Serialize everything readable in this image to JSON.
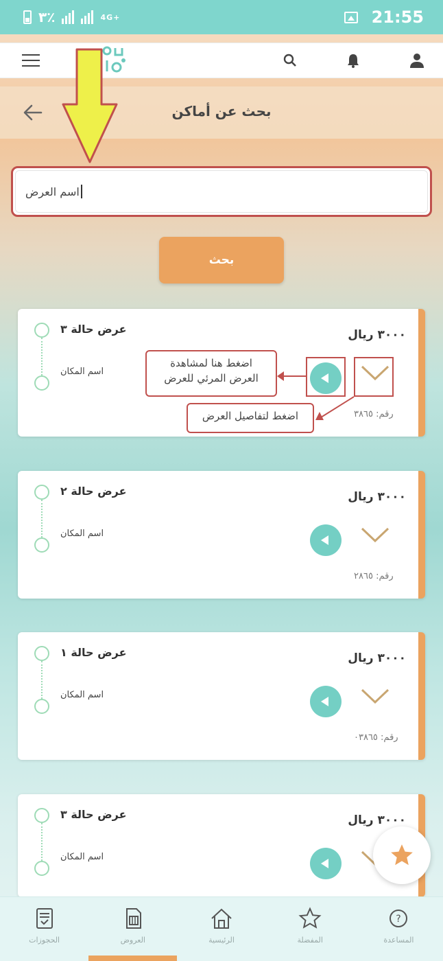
{
  "status_bar": {
    "battery_percent": "٣٪",
    "network": "4G+",
    "time": "21:55"
  },
  "header": {
    "logo_text": "ن\nا|ن",
    "icons": [
      "menu-icon",
      "search-icon",
      "bell-icon",
      "user-icon"
    ]
  },
  "subheader": {
    "title": "بحث عن أماكن"
  },
  "search": {
    "value": "اسم العرض"
  },
  "search_button": {
    "label": "بحث"
  },
  "cards": [
    {
      "from": "عرض حالة ٣",
      "to": "اسم المكان",
      "price": "٣٠٠٠ ريال",
      "code": "رقم: ٣٨٦٥"
    },
    {
      "from": "عرض حالة ٢",
      "to": "اسم المكان",
      "price": "٣٠٠٠ ريال",
      "code": "رقم: ٢٨٦٥"
    },
    {
      "from": "عرض حالة ١",
      "to": "اسم المكان",
      "price": "٣٠٠٠ ريال",
      "code": "رقم: ٠٣٨٦٥"
    },
    {
      "from": "عرض حالة ٣",
      "to": "اسم المكان",
      "price": "٣٠٠٠ ريال",
      "code": ""
    }
  ],
  "callouts": {
    "play": "اضغط هنا لمشاهدة\nالعرض المرئي للعرض",
    "chevron": "اضغط لتفاصيل العرض"
  },
  "bottom_nav": [
    {
      "label": "الحجوزات",
      "icon": "receipt-icon"
    },
    {
      "label": "العروض",
      "icon": "sim-card-icon"
    },
    {
      "label": "الرئيسية",
      "icon": "home-icon"
    },
    {
      "label": "المفضلة",
      "icon": "star-icon"
    },
    {
      "label": "المساعدة",
      "icon": "help-icon"
    }
  ],
  "colors": {
    "accent": "#eba35f",
    "teal": "#74cfc4",
    "annotation": "#c0504d",
    "status_bar": "#7fd6cd"
  }
}
